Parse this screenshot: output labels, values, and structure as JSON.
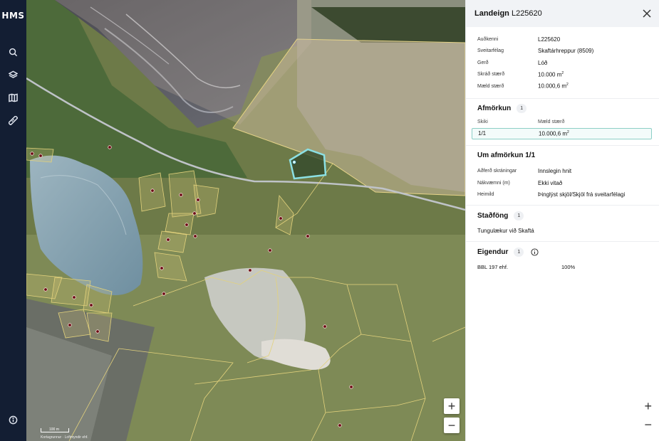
{
  "nav": {
    "logo": "HMS",
    "items": [
      "search-icon",
      "layers-icon",
      "map-icon",
      "ruler-icon"
    ],
    "info": "info-icon"
  },
  "map": {
    "scale_label": "100 m",
    "attribution": "Kortagrunnur · Loftmyndir ehf.",
    "zoom_in": "+",
    "zoom_out": "−"
  },
  "panel": {
    "title_bold": "Landeign",
    "title_id": "L225620",
    "details": [
      {
        "key": "Auðkenni",
        "value": "L225620",
        "sup": ""
      },
      {
        "key": "Sveitarfélag",
        "value": "Skaftárhreppur (8509)",
        "sup": ""
      },
      {
        "key": "Gerð",
        "value": "Lóð",
        "sup": ""
      },
      {
        "key": "Skráð stærð",
        "value": "10.000 m",
        "sup": "2"
      },
      {
        "key": "Mæld stærð",
        "value": "10.000,6 m",
        "sup": "2"
      }
    ],
    "afmorkun": {
      "title": "Afmörkun",
      "count": "1",
      "col_skiki": "Skiki",
      "col_maeld": "Mæld stærð",
      "row_skiki": "1/1",
      "row_value": "10.000,6 m",
      "row_sup": "2"
    },
    "um_afmorkun": {
      "title": "Um afmörkun 1/1",
      "rows": [
        {
          "key": "Aðferð skráningar",
          "value": "Innslegin hnit"
        },
        {
          "key": "Nákvæmni (m)",
          "value": "Ekki vitað"
        },
        {
          "key": "Heimild",
          "value": "Þinglýst skjöl/Skjöl frá sveitarfélagi"
        }
      ]
    },
    "stadfong": {
      "title": "Staðföng",
      "count": "1",
      "address": "Tungulækur við Skaftá"
    },
    "eigendur": {
      "title": "Eigendur",
      "count": "1",
      "owner": "BBL 197 ehf.",
      "share": "100%"
    },
    "zoom_in": "+",
    "zoom_out": "−"
  }
}
